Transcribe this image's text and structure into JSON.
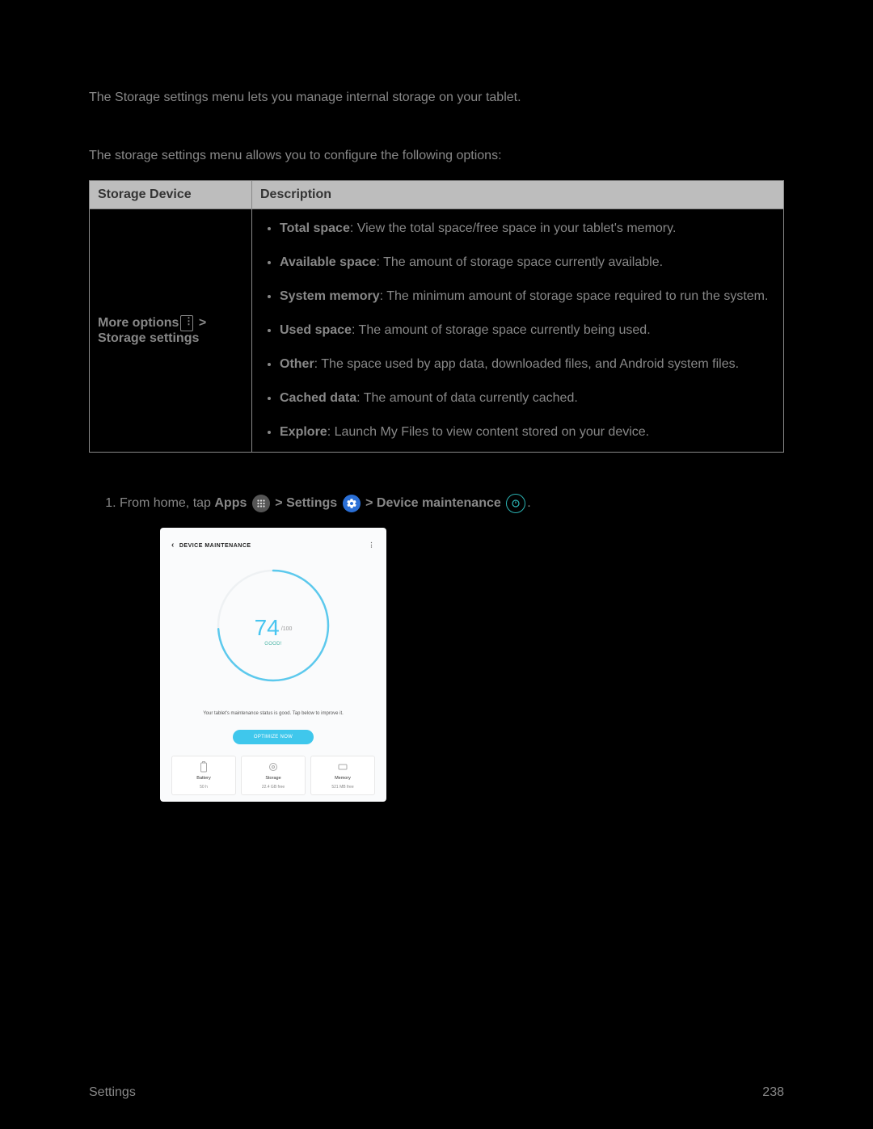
{
  "intro": "The Storage settings menu lets you manage internal storage on your tablet.",
  "subIntro": "The storage settings menu allows you to configure the following options:",
  "table": {
    "col1": "Storage Device",
    "col2": "Description",
    "leftLine1a": "More options",
    "leftLine1b": " > ",
    "leftLine2": "Storage settings",
    "items": [
      {
        "bold": "Total space",
        "rest": ": View the total space/free space in your tablet's memory."
      },
      {
        "bold": "Available space",
        "rest": ": The amount of storage space currently available."
      },
      {
        "bold": "System memory",
        "rest": ": The minimum amount of storage space required to run the system."
      },
      {
        "bold": "Used space",
        "rest": ": The amount of storage space currently being used."
      },
      {
        "bold": "Other",
        "rest": ": The space used by app data, downloaded files, and Android system files."
      },
      {
        "bold": "Cached data",
        "rest": ": The amount of data currently cached."
      },
      {
        "bold": "Explore",
        "rest": ": Launch My Files to view content stored on your device."
      }
    ]
  },
  "access": {
    "prefix": "From home, tap ",
    "apps": "Apps",
    "sep": " > ",
    "settings": "Settings",
    "device": "Device maintenance",
    "period": "."
  },
  "screenshot": {
    "title": "DEVICE MAINTENANCE",
    "score": "74",
    "scoreMax": "/100",
    "good": "GOOD!",
    "desc": "Your tablet's maintenance status is good. Tap below to improve it.",
    "optimize": "OPTIMIZE NOW",
    "cards": [
      {
        "label": "Battery",
        "value": "50 h"
      },
      {
        "label": "Storage",
        "value": "22.4 GB free"
      },
      {
        "label": "Memory",
        "value": "521 MB free"
      }
    ]
  },
  "footer": {
    "left": "Settings",
    "right": "238"
  }
}
